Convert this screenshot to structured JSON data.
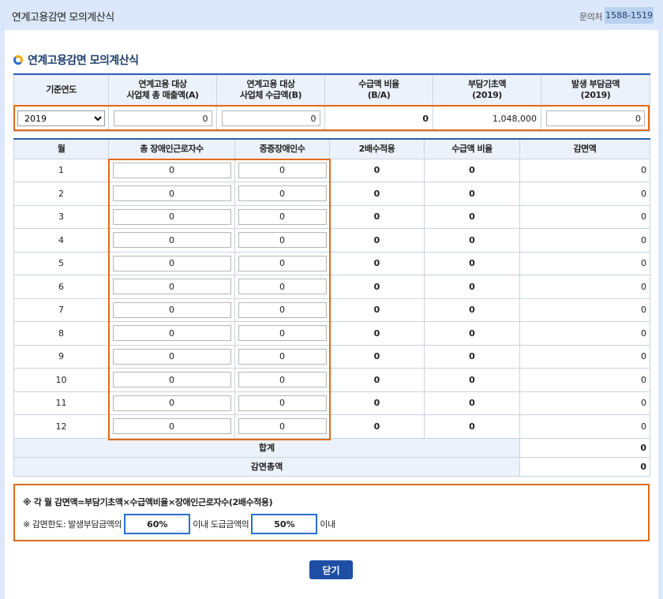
{
  "window": {
    "title": "연계고용감면 모의계산식",
    "contact_label": "문의처",
    "contact_number": "1588-1519"
  },
  "section_title": "연계고용감면 모의계산식",
  "top_table": {
    "headers": [
      "기준연도",
      "연계고용 대상\n사업체 총 매출액(A)",
      "연계고용 대상\n사업체 수급액(B)",
      "수급액 비율\n(B/A)",
      "부담기초액\n(2019)",
      "발생 부담금액\n(2019)"
    ],
    "year": "2019",
    "total_sales": "0",
    "receipt_amount": "0",
    "ratio": "0",
    "base_amount": "1,048,000",
    "levy_amount": "0"
  },
  "monthly_table": {
    "headers": [
      "월",
      "총 장애인근로자수",
      "중증장애인수",
      "2배수적용",
      "수급액 비율",
      "감면액"
    ],
    "rows": [
      {
        "month": "1",
        "workers": "0",
        "severe": "0",
        "double": "0",
        "ratio": "0",
        "reduction": "0"
      },
      {
        "month": "2",
        "workers": "0",
        "severe": "0",
        "double": "0",
        "ratio": "0",
        "reduction": "0"
      },
      {
        "month": "3",
        "workers": "0",
        "severe": "0",
        "double": "0",
        "ratio": "0",
        "reduction": "0"
      },
      {
        "month": "4",
        "workers": "0",
        "severe": "0",
        "double": "0",
        "ratio": "0",
        "reduction": "0"
      },
      {
        "month": "5",
        "workers": "0",
        "severe": "0",
        "double": "0",
        "ratio": "0",
        "reduction": "0"
      },
      {
        "month": "6",
        "workers": "0",
        "severe": "0",
        "double": "0",
        "ratio": "0",
        "reduction": "0"
      },
      {
        "month": "7",
        "workers": "0",
        "severe": "0",
        "double": "0",
        "ratio": "0",
        "reduction": "0"
      },
      {
        "month": "8",
        "workers": "0",
        "severe": "0",
        "double": "0",
        "ratio": "0",
        "reduction": "0"
      },
      {
        "month": "9",
        "workers": "0",
        "severe": "0",
        "double": "0",
        "ratio": "0",
        "reduction": "0"
      },
      {
        "month": "10",
        "workers": "0",
        "severe": "0",
        "double": "0",
        "ratio": "0",
        "reduction": "0"
      },
      {
        "month": "11",
        "workers": "0",
        "severe": "0",
        "double": "0",
        "ratio": "0",
        "reduction": "0"
      },
      {
        "month": "12",
        "workers": "0",
        "severe": "0",
        "double": "0",
        "ratio": "0",
        "reduction": "0"
      }
    ],
    "sum_label": "합계",
    "sum_value": "0",
    "total_label": "감면총액",
    "total_value": "0"
  },
  "notes": {
    "formula": "※ 각 월 감면액=부담기초액×수급액비율×장애인근로자수(2배수적용)",
    "limit_prefix": "※ 감면한도: 발생부담금액의",
    "limit_pct1": "60%",
    "limit_middle": "이내 도급금액의",
    "limit_pct2": "50%",
    "limit_suffix": "이내"
  },
  "close_label": "닫기",
  "colors": {
    "header_blue": "#2a5fb0",
    "highlight_orange": "#e06a1b",
    "button_blue": "#1e4fa5",
    "background": "#dbe7fa"
  }
}
